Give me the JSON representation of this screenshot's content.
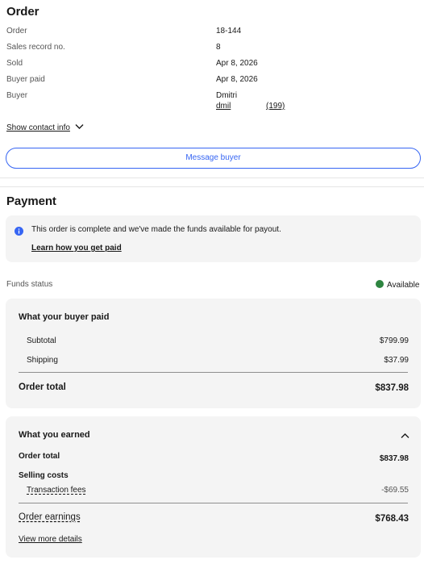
{
  "order": {
    "title": "Order",
    "rows": [
      {
        "label": "Order",
        "value": "18-144"
      },
      {
        "label": "Sales record no.",
        "value": "8"
      },
      {
        "label": "Sold",
        "value": "Apr 8, 2026"
      },
      {
        "label": "Buyer paid",
        "value": "Apr 8, 2026"
      }
    ],
    "buyer_label": "Buyer",
    "buyer_name": "Dmitri",
    "buyer_username": "dmil",
    "buyer_feedback": "(199)",
    "show_contact": "Show contact info",
    "message_button": "Message buyer"
  },
  "payment": {
    "title": "Payment",
    "notice_text": "This order is complete and we've made the funds available for payout.",
    "notice_link": "Learn how you get paid",
    "funds_status_label": "Funds status",
    "funds_status_value": "Available",
    "status_color": "#2e8540"
  },
  "buyer_paid": {
    "title": "What your buyer paid",
    "subtotal_label": "Subtotal",
    "subtotal_value": "$799.99",
    "shipping_label": "Shipping",
    "shipping_value": "$37.99",
    "total_label": "Order total",
    "total_value": "$837.98"
  },
  "earned": {
    "title": "What you earned",
    "order_total_label": "Order total",
    "order_total_value": "$837.98",
    "selling_costs_label": "Selling costs",
    "fees_label": "Transaction fees",
    "fees_value": "-$69.55",
    "earnings_label": "Order earnings",
    "earnings_value": "$768.43",
    "details_link": "View more details"
  },
  "colors": {
    "accent": "#3665f3",
    "info": "#3665f3"
  }
}
